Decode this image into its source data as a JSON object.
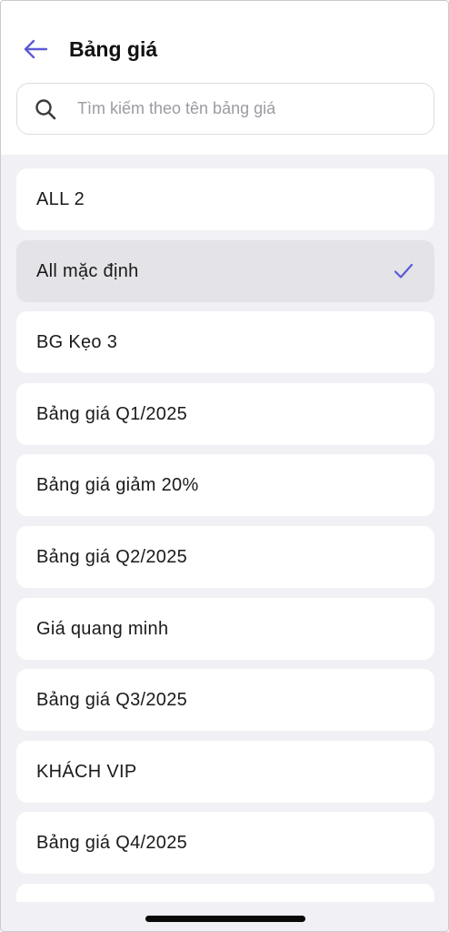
{
  "header": {
    "title": "Bảng giá",
    "back_icon": "arrow-left-icon",
    "accent_color": "#5b5bd6"
  },
  "search": {
    "placeholder": "Tìm kiếm theo tên bảng giá",
    "value": "",
    "icon": "search-icon"
  },
  "price_lists": [
    {
      "label": "ALL 2",
      "selected": false
    },
    {
      "label": "All mặc định",
      "selected": true
    },
    {
      "label": "BG Kẹo 3",
      "selected": false
    },
    {
      "label": "Bảng giá Q1/2025",
      "selected": false
    },
    {
      "label": "Bảng giá giảm 20%",
      "selected": false
    },
    {
      "label": "Bảng giá Q2/2025",
      "selected": false
    },
    {
      "label": "Giá quang minh",
      "selected": false
    },
    {
      "label": "Bảng giá Q3/2025",
      "selected": false
    },
    {
      "label": "KHÁCH VIP",
      "selected": false
    },
    {
      "label": "Bảng giá Q4/2025",
      "selected": false
    }
  ],
  "selected_icon": "checkmark-icon"
}
